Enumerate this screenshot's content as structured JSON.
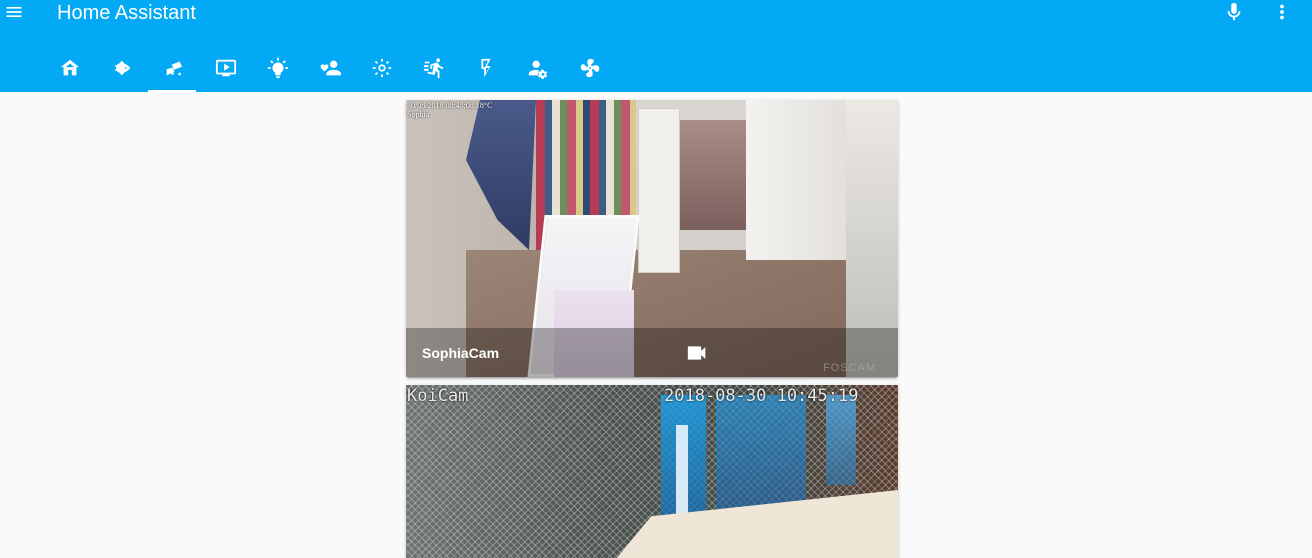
{
  "app": {
    "title": "Home Assistant",
    "accent_color": "#03a9f4",
    "background_color": "#fafafa"
  },
  "toolbar": {
    "menu_icon": "menu-icon",
    "mic_icon": "microphone-icon",
    "more_icon": "dots-vertical-icon"
  },
  "tabs": [
    {
      "icon": "home-icon",
      "active": false
    },
    {
      "icon": "fish-icon",
      "active": false
    },
    {
      "icon": "cctv-icon",
      "active": true
    },
    {
      "icon": "television-icon",
      "active": false
    },
    {
      "icon": "lightbulb-icon",
      "active": false
    },
    {
      "icon": "account-heart-icon",
      "active": false
    },
    {
      "icon": "brightness-icon",
      "active": false
    },
    {
      "icon": "run-icon",
      "active": false
    },
    {
      "icon": "flash-icon",
      "active": false
    },
    {
      "icon": "account-settings-icon",
      "active": false
    },
    {
      "icon": "fan-icon",
      "active": false
    }
  ],
  "cameras": [
    {
      "name": "SophiaCam",
      "overlay_timestamp": "30/08/2018 08:45:08 18°C",
      "overlay_name": "Sophia",
      "overlay_brand": "FOSCAM",
      "action_icon": "video-icon"
    },
    {
      "overlay_name": "KoiCam",
      "overlay_timestamp": "2018-08-30 10:45:19"
    }
  ]
}
